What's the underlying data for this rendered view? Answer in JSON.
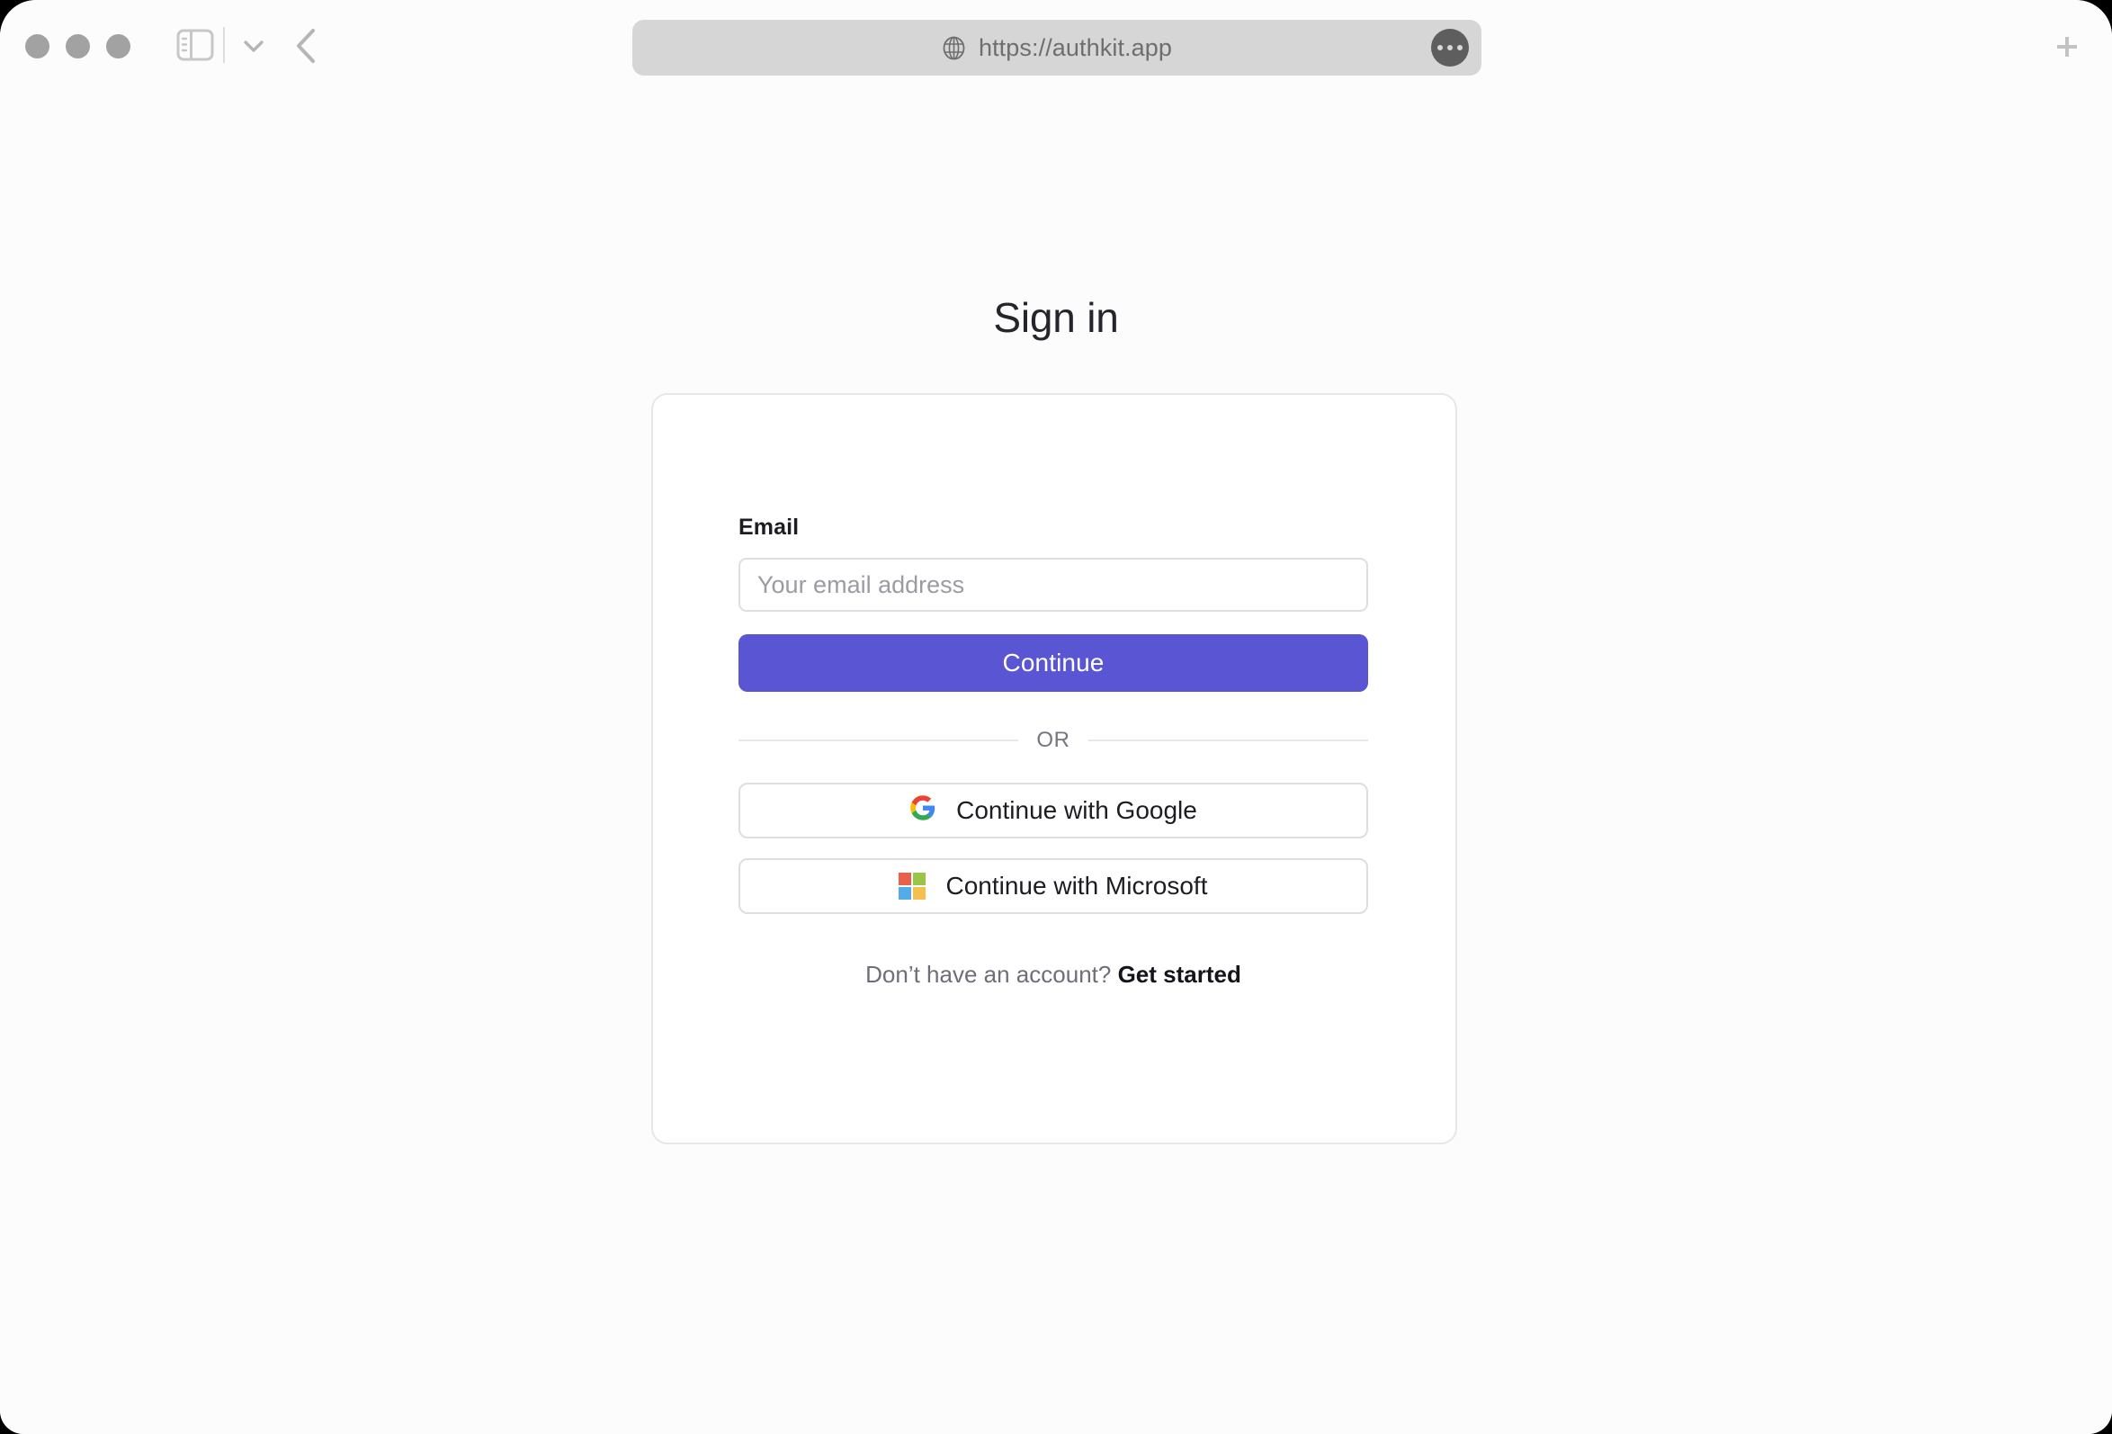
{
  "browser": {
    "traffic_lights": [
      "close",
      "minimize",
      "zoom"
    ],
    "sidebar_toggle_icon": "sidebar-icon",
    "tab_overview_icon": "chevron-down-icon",
    "back_icon": "chevron-left-icon",
    "address": {
      "security_icon": "globe-icon",
      "url": "https://authkit.app",
      "more_icon": "ellipsis-icon"
    },
    "new_tab_icon": "plus-icon"
  },
  "page": {
    "title": "Sign in",
    "form": {
      "email_label": "Email",
      "email_value": "",
      "email_placeholder": "Your email address",
      "continue_label": "Continue"
    },
    "divider_label": "OR",
    "social": [
      {
        "provider": "google",
        "label": "Continue with Google",
        "icon": "google-icon"
      },
      {
        "provider": "microsoft",
        "label": "Continue with Microsoft",
        "icon": "microsoft-icon"
      }
    ],
    "signup": {
      "prompt": "Don’t have an account?",
      "link_label": "Get started"
    }
  },
  "colors": {
    "accent": "#5a55d2",
    "page_bg": "#fcfcfd",
    "card_bg": "#ffffff",
    "card_border": "#e5e7eb",
    "input_border": "#dcdee3",
    "address_bar_bg": "#d6d6d6",
    "muted_text": "#6e6e78",
    "title_text": "#25252b",
    "google_red": "#ea4335",
    "google_yellow": "#fbbc05",
    "google_green": "#34a853",
    "google_blue": "#4285f4",
    "microsoft_red": "#e8614a",
    "microsoft_green": "#9bc546",
    "microsoft_blue": "#55aae8",
    "microsoft_yellow": "#f5c04e"
  }
}
